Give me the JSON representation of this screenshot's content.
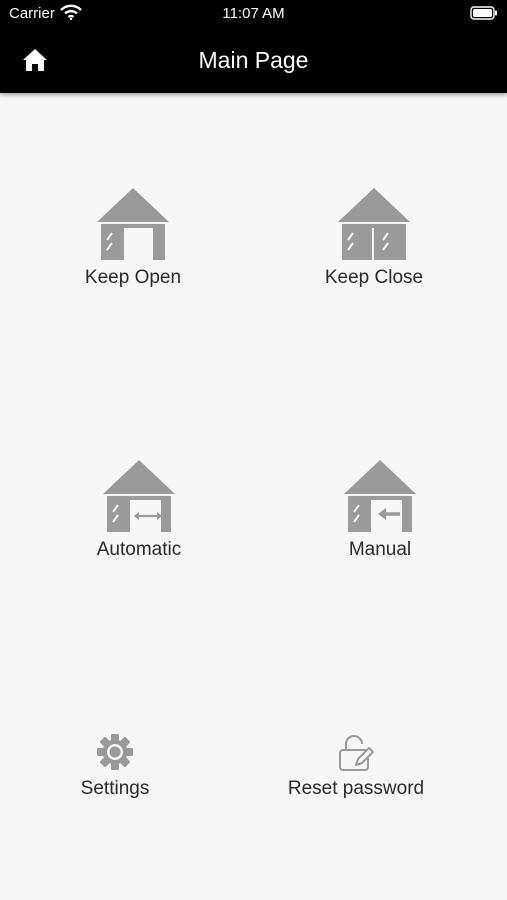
{
  "status_bar": {
    "carrier": "Carrier",
    "time": "11:07 AM"
  },
  "header": {
    "title": "Main Page",
    "home_icon": "home-icon"
  },
  "tiles": [
    {
      "label": "Keep Open",
      "icon": "garage-open-icon"
    },
    {
      "label": "Keep Close",
      "icon": "garage-closed-icon"
    },
    {
      "label": "Automatic",
      "icon": "garage-automatic-icon"
    },
    {
      "label": "Manual",
      "icon": "garage-manual-icon"
    }
  ],
  "bottom_actions": [
    {
      "label": "Settings",
      "icon": "gear-icon"
    },
    {
      "label": "Reset password",
      "icon": "lock-edit-icon"
    }
  ],
  "colors": {
    "header_bg": "#000000",
    "page_bg": "#f7f7f7",
    "icon_gray": "#9a9a9a"
  }
}
